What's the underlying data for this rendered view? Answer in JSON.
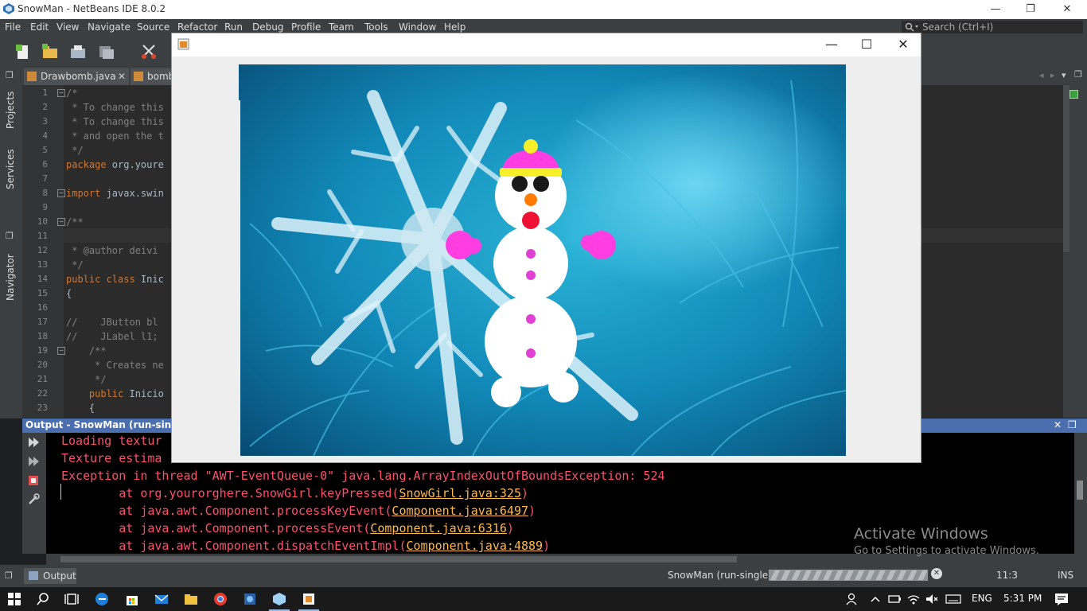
{
  "window": {
    "title": "SnowMan - NetBeans IDE 8.0.2",
    "minimize": "—",
    "restore": "❐",
    "close": "✕"
  },
  "menu": [
    "File",
    "Edit",
    "View",
    "Navigate",
    "Source",
    "Refactor",
    "Run",
    "Debug",
    "Profile",
    "Team",
    "Tools",
    "Window",
    "Help"
  ],
  "search": {
    "placeholder": "Search (Ctrl+I)"
  },
  "tabs": [
    {
      "label": "Drawbomb.java"
    },
    {
      "label": "bomb"
    }
  ],
  "tab_close": "✕",
  "side_panels": {
    "projects": "Projects",
    "services": "Services",
    "navigator": "Navigator"
  },
  "editor": {
    "lines": [
      {
        "n": "1",
        "text": "/*",
        "cls": "cmt"
      },
      {
        "n": "2",
        "text": " * To change this",
        "cls": "cmt"
      },
      {
        "n": "3",
        "text": " * To change this",
        "cls": "cmt"
      },
      {
        "n": "4",
        "text": " * and open the t",
        "cls": "cmt"
      },
      {
        "n": "5",
        "text": " */",
        "cls": "cmt"
      },
      {
        "n": "6",
        "text": "package org.youre",
        "cls": "tx"
      },
      {
        "n": "7",
        "text": "",
        "cls": "tx"
      },
      {
        "n": "8",
        "text": "import javax.swin",
        "cls": "tx"
      },
      {
        "n": "9",
        "text": "",
        "cls": "tx"
      },
      {
        "n": "10",
        "text": "/**",
        "cls": "cmt"
      },
      {
        "n": "11",
        "text": " *",
        "cls": "cmt"
      },
      {
        "n": "12",
        "text": " * @author deivi",
        "cls": "cmt"
      },
      {
        "n": "13",
        "text": " */",
        "cls": "cmt"
      },
      {
        "n": "14",
        "text": "public class Inic",
        "cls": "tx"
      },
      {
        "n": "15",
        "text": "{",
        "cls": "tx"
      },
      {
        "n": "16",
        "text": "",
        "cls": "tx"
      },
      {
        "n": "17",
        "text": "//    JButton bl",
        "cls": "cmt"
      },
      {
        "n": "18",
        "text": "//    JLabel l1;",
        "cls": "cmt"
      },
      {
        "n": "19",
        "text": "    /**",
        "cls": "cmt"
      },
      {
        "n": "20",
        "text": "     * Creates ne",
        "cls": "cmt"
      },
      {
        "n": "21",
        "text": "     */",
        "cls": "cmt"
      },
      {
        "n": "22",
        "text": "    public Inicio",
        "cls": "tx"
      },
      {
        "n": "23",
        "text": "    {",
        "cls": "tx"
      }
    ]
  },
  "output": {
    "title": "Output - SnowMan (run-single)",
    "lines": [
      {
        "pre": "Loading textur",
        "link": "",
        "post": ""
      },
      {
        "pre": "Texture estima",
        "link": "",
        "post": ""
      },
      {
        "pre": "Exception in thread \"AWT-EventQueue-0\" java.lang.ArrayIndexOutOfBoundsException: 524",
        "link": "",
        "post": ""
      },
      {
        "pre": "        at org.yourorghere.SnowGirl.keyPressed(",
        "link": "SnowGirl.java:325",
        "post": ")"
      },
      {
        "pre": "        at java.awt.Component.processKeyEvent(",
        "link": "Component.java:6497",
        "post": ")"
      },
      {
        "pre": "        at java.awt.Component.processEvent(",
        "link": "Component.java:6316",
        "post": ")"
      },
      {
        "pre": "        at java.awt.Component.dispatchEventImpl(",
        "link": "Component.java:4889",
        "post": ")"
      }
    ],
    "close": "✕",
    "restore": "❐"
  },
  "watermark": {
    "title": "Activate Windows",
    "subtitle": "Go to Settings to activate Windows."
  },
  "status": {
    "tab": "Output",
    "run": "SnowMan (run-single)",
    "position": "11:3",
    "mode": "INS"
  },
  "taskbar": {
    "lang": "ENG",
    "time": "5:31 PM"
  },
  "java_frame": {
    "minimize": "—",
    "maximize": "☐",
    "close": "✕"
  },
  "colors": {
    "ide_bg": "#3c3f41",
    "editor_bg": "#2b2b2b",
    "output_text": "#ff4f6b",
    "link": "#ffb84d",
    "snow_pink": "#ff3de0"
  }
}
